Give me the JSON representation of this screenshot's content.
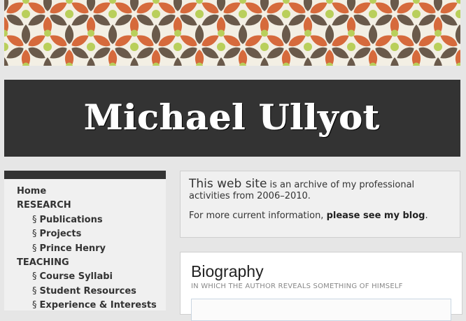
{
  "site_title": "Michael Ullyot",
  "nav": [
    {
      "label": "Home",
      "level": 0
    },
    {
      "label": "RESEARCH",
      "level": 0
    },
    {
      "label": "Publications",
      "level": 1
    },
    {
      "label": "Projects",
      "level": 1
    },
    {
      "label": "Prince Henry",
      "level": 1
    },
    {
      "label": "TEACHING",
      "level": 0
    },
    {
      "label": "Course Syllabi",
      "level": 1
    },
    {
      "label": "Student Resources",
      "level": 1
    },
    {
      "label": "Experience & Interests",
      "level": 1
    }
  ],
  "section_marker": "§",
  "intro": {
    "highlight": "This web site",
    "text": " is an archive of my professional activities from 2006–2010.",
    "more_prefix": "For more current information, ",
    "more_link": "please see my blog",
    "more_suffix": "."
  },
  "biography": {
    "title": "Biography",
    "subtitle": "IN WHICH THE AUTHOR REVEALS SOMETHING OF HIMSELF"
  },
  "colors": {
    "banner_orange": "#d66a3c",
    "banner_brown": "#6a5a4b",
    "banner_green": "#b9cf5b",
    "title_bar": "#333333"
  }
}
